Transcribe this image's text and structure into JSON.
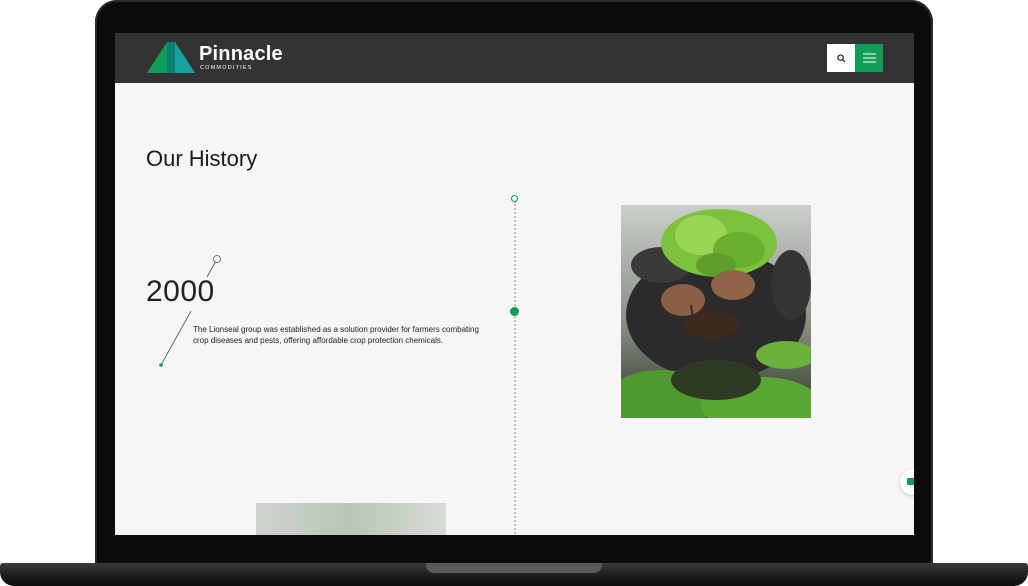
{
  "brand": {
    "name": "Pinnacle",
    "subtitle": "COMMODITIES",
    "colors": {
      "green": "#0f9d58",
      "teal": "#16a3a0",
      "header": "#333333"
    }
  },
  "header": {
    "search_icon": "search-icon",
    "menu_icon": "hamburger-menu-icon"
  },
  "history": {
    "title": "Our History",
    "entries": [
      {
        "year": "2000",
        "description": "The Lionseal group was established as a solution provider for farmers combating crop diseases and pests, offering affordable crop protection chemicals."
      }
    ]
  }
}
